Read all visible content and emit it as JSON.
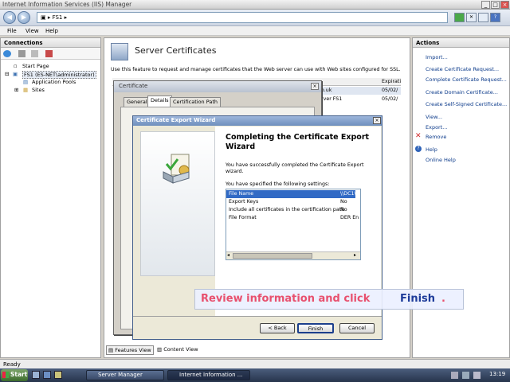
{
  "window": {
    "title": "Internet Information Services (IIS) Manager"
  },
  "address": {
    "path": "FS1"
  },
  "menu": {
    "file": "File",
    "view": "View",
    "help": "Help"
  },
  "connections": {
    "header": "Connections",
    "tree": {
      "start_page": "Start Page",
      "server": "FS1 (ES-NET\\administrator)",
      "app_pools": "Application Pools",
      "sites": "Sites"
    }
  },
  "main": {
    "title": "Server Certificates",
    "description": "Use this feature to request and manage certificates that the Web server can use with Web sites configured for SSL.",
    "col_expiration": "Expirati",
    "rows": [
      {
        "name": "o.uk",
        "expires": "05/02/"
      },
      {
        "name": "rver FS1",
        "expires": "05/02/"
      }
    ],
    "view_features": "Features View",
    "view_content": "Content View"
  },
  "certificate_dialog": {
    "title": "Certificate",
    "tabs": [
      "General",
      "Details",
      "Certification Path"
    ]
  },
  "wizard": {
    "title": "Certificate Export Wizard",
    "heading_line1": "Completing the Certificate Export",
    "heading_line2": "Wizard",
    "intro_line1": "You have successfully completed the Certificate Export",
    "intro_line2": "wizard.",
    "settings_label": "You have specified the following settings:",
    "settings": [
      {
        "name": "File Name",
        "value": "\\\\DC1\\"
      },
      {
        "name": "Export Keys",
        "value": "No"
      },
      {
        "name": "Include all certificates in the certification path",
        "value": "No"
      },
      {
        "name": "File Format",
        "value": "DER En"
      }
    ],
    "back": "< Back",
    "finish": "Finish",
    "cancel": "Cancel"
  },
  "actions": {
    "header": "Actions",
    "items": [
      "Import...",
      "Create Certificate Request...",
      "Complete Certificate Request...",
      "Create Domain Certificate...",
      "Create Self-Signed Certificate...",
      "View...",
      "Export...",
      "Remove",
      "Help",
      "Online Help"
    ]
  },
  "callout": {
    "text": "Review information and click",
    "highlight": "Finish",
    "period": ".",
    "color": "#e8506e",
    "highlight_color": "#1e3c9a"
  },
  "status": {
    "text": "Ready"
  },
  "taskbar": {
    "start": "Start",
    "tasks": [
      "Server Manager",
      "Internet Information ..."
    ],
    "clock": "13:19"
  }
}
